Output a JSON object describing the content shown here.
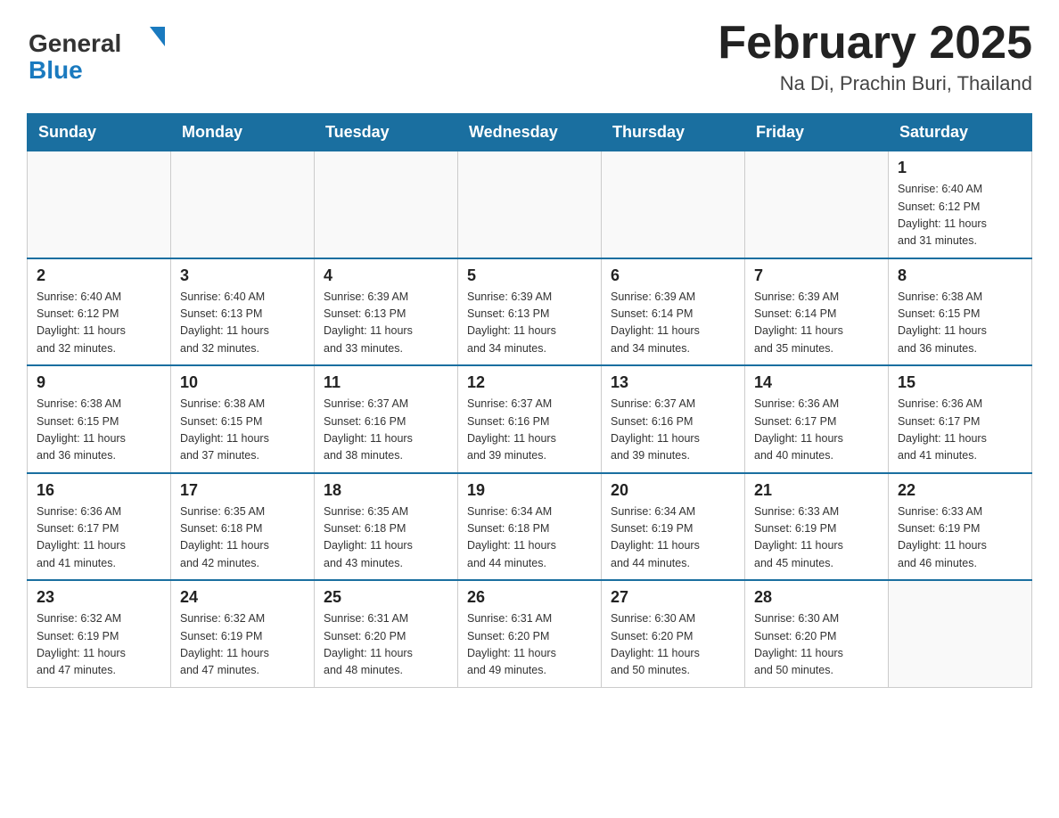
{
  "header": {
    "logo": {
      "general_text": "General",
      "blue_text": "Blue"
    },
    "title": "February 2025",
    "location": "Na Di, Prachin Buri, Thailand"
  },
  "weekdays": [
    "Sunday",
    "Monday",
    "Tuesday",
    "Wednesday",
    "Thursday",
    "Friday",
    "Saturday"
  ],
  "weeks": [
    [
      {
        "day": "",
        "info": ""
      },
      {
        "day": "",
        "info": ""
      },
      {
        "day": "",
        "info": ""
      },
      {
        "day": "",
        "info": ""
      },
      {
        "day": "",
        "info": ""
      },
      {
        "day": "",
        "info": ""
      },
      {
        "day": "1",
        "info": "Sunrise: 6:40 AM\nSunset: 6:12 PM\nDaylight: 11 hours\nand 31 minutes."
      }
    ],
    [
      {
        "day": "2",
        "info": "Sunrise: 6:40 AM\nSunset: 6:12 PM\nDaylight: 11 hours\nand 32 minutes."
      },
      {
        "day": "3",
        "info": "Sunrise: 6:40 AM\nSunset: 6:13 PM\nDaylight: 11 hours\nand 32 minutes."
      },
      {
        "day": "4",
        "info": "Sunrise: 6:39 AM\nSunset: 6:13 PM\nDaylight: 11 hours\nand 33 minutes."
      },
      {
        "day": "5",
        "info": "Sunrise: 6:39 AM\nSunset: 6:13 PM\nDaylight: 11 hours\nand 34 minutes."
      },
      {
        "day": "6",
        "info": "Sunrise: 6:39 AM\nSunset: 6:14 PM\nDaylight: 11 hours\nand 34 minutes."
      },
      {
        "day": "7",
        "info": "Sunrise: 6:39 AM\nSunset: 6:14 PM\nDaylight: 11 hours\nand 35 minutes."
      },
      {
        "day": "8",
        "info": "Sunrise: 6:38 AM\nSunset: 6:15 PM\nDaylight: 11 hours\nand 36 minutes."
      }
    ],
    [
      {
        "day": "9",
        "info": "Sunrise: 6:38 AM\nSunset: 6:15 PM\nDaylight: 11 hours\nand 36 minutes."
      },
      {
        "day": "10",
        "info": "Sunrise: 6:38 AM\nSunset: 6:15 PM\nDaylight: 11 hours\nand 37 minutes."
      },
      {
        "day": "11",
        "info": "Sunrise: 6:37 AM\nSunset: 6:16 PM\nDaylight: 11 hours\nand 38 minutes."
      },
      {
        "day": "12",
        "info": "Sunrise: 6:37 AM\nSunset: 6:16 PM\nDaylight: 11 hours\nand 39 minutes."
      },
      {
        "day": "13",
        "info": "Sunrise: 6:37 AM\nSunset: 6:16 PM\nDaylight: 11 hours\nand 39 minutes."
      },
      {
        "day": "14",
        "info": "Sunrise: 6:36 AM\nSunset: 6:17 PM\nDaylight: 11 hours\nand 40 minutes."
      },
      {
        "day": "15",
        "info": "Sunrise: 6:36 AM\nSunset: 6:17 PM\nDaylight: 11 hours\nand 41 minutes."
      }
    ],
    [
      {
        "day": "16",
        "info": "Sunrise: 6:36 AM\nSunset: 6:17 PM\nDaylight: 11 hours\nand 41 minutes."
      },
      {
        "day": "17",
        "info": "Sunrise: 6:35 AM\nSunset: 6:18 PM\nDaylight: 11 hours\nand 42 minutes."
      },
      {
        "day": "18",
        "info": "Sunrise: 6:35 AM\nSunset: 6:18 PM\nDaylight: 11 hours\nand 43 minutes."
      },
      {
        "day": "19",
        "info": "Sunrise: 6:34 AM\nSunset: 6:18 PM\nDaylight: 11 hours\nand 44 minutes."
      },
      {
        "day": "20",
        "info": "Sunrise: 6:34 AM\nSunset: 6:19 PM\nDaylight: 11 hours\nand 44 minutes."
      },
      {
        "day": "21",
        "info": "Sunrise: 6:33 AM\nSunset: 6:19 PM\nDaylight: 11 hours\nand 45 minutes."
      },
      {
        "day": "22",
        "info": "Sunrise: 6:33 AM\nSunset: 6:19 PM\nDaylight: 11 hours\nand 46 minutes."
      }
    ],
    [
      {
        "day": "23",
        "info": "Sunrise: 6:32 AM\nSunset: 6:19 PM\nDaylight: 11 hours\nand 47 minutes."
      },
      {
        "day": "24",
        "info": "Sunrise: 6:32 AM\nSunset: 6:19 PM\nDaylight: 11 hours\nand 47 minutes."
      },
      {
        "day": "25",
        "info": "Sunrise: 6:31 AM\nSunset: 6:20 PM\nDaylight: 11 hours\nand 48 minutes."
      },
      {
        "day": "26",
        "info": "Sunrise: 6:31 AM\nSunset: 6:20 PM\nDaylight: 11 hours\nand 49 minutes."
      },
      {
        "day": "27",
        "info": "Sunrise: 6:30 AM\nSunset: 6:20 PM\nDaylight: 11 hours\nand 50 minutes."
      },
      {
        "day": "28",
        "info": "Sunrise: 6:30 AM\nSunset: 6:20 PM\nDaylight: 11 hours\nand 50 minutes."
      },
      {
        "day": "",
        "info": ""
      }
    ]
  ]
}
